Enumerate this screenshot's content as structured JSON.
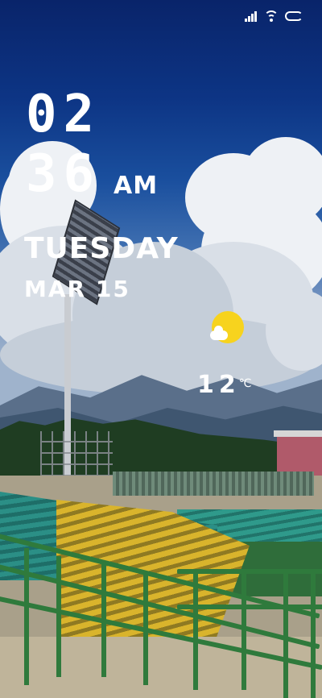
{
  "status_bar": {
    "signal_icon": "signal-bars",
    "wifi_icon": "wifi",
    "battery_icon": "battery"
  },
  "lockscreen": {
    "clock": {
      "hour": "02",
      "minute": "36",
      "ampm": "AM"
    },
    "day": "TUESDAY",
    "date": "MAR 15",
    "weather": {
      "icon": "partly-sunny",
      "temperature": "12",
      "unit": "℃"
    }
  },
  "colors": {
    "sky": "#0d3585",
    "sun": "#f7d31e",
    "text": "#ffffff",
    "railing": "#2f7a3c"
  }
}
